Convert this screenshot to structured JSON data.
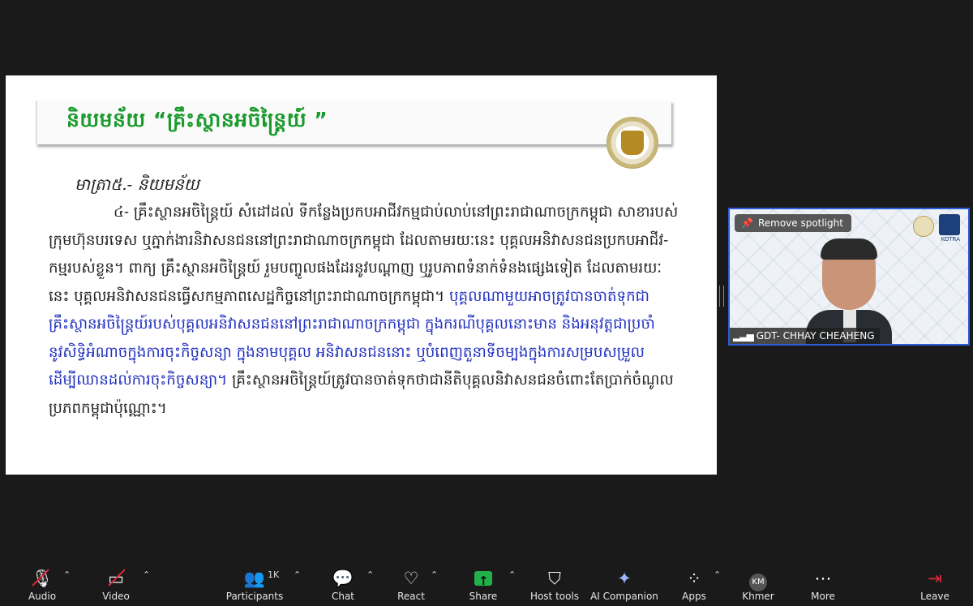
{
  "slide": {
    "title": "និយមន័យ “គ្រឹះស្ថានអចិន្ត្រៃយ៍ ”",
    "subtitle": "មាត្រា៥.- និយមន័យ",
    "body_lines": [
      "៤- គ្រឹះស្ថានអចិន្ត្រៃយ៍ សំដៅដល់ ទីកន្លែងប្រកបអាជីវកម្មជាប់លាប់នៅព្រះរាជាណាចក្រកម្ពុជា សាខារបស់",
      "ក្រុមហ៊ុនបរទេស ឬភ្នាក់ងារនិវាសនជននៅព្រះរាជាណាចក្រកម្ពុជា ដែលតាមរយៈនេះ បុគ្គលអនិវាសនជនប្រកបអាជីវ-",
      "កម្មរបស់ខ្លួន។ ពាក្យ គ្រឹះស្ថានអចិន្ត្រៃយ៍ រួមបញ្ចូលផងដែរនូវបណ្ដាញ ឬរូបភាពទំនាក់ទំនងផ្សេងទៀត ដែលតាមរយៈ",
      "នេះ បុគ្គលអនិវាសនជនធ្វើសកម្មភាពសេដ្ឋកិច្ចនៅព្រះរាជាណាចក្រកម្ពុជា។",
      "បុគ្គលណាមួយអាចត្រូវបានចាត់ទុកជា",
      "គ្រឹះស្ថានអចិន្ត្រៃយ៍របស់បុគ្គលអនិវាសនជននៅព្រះរាជាណាចក្រកម្ពុជា ក្នុងករណីបុគ្គលនោះមាន និងអនុវត្តជាប្រចាំ",
      "នូវសិទ្ធិអំណាចក្នុងការចុះកិច្ចសន្យា ក្នុងនាមបុគ្គល អនិវាសនជននោះ ឬបំពេញតួនាទីចម្បងក្នុងការសម្របសម្រួល",
      "ដើម្បីឈានដល់ការចុះកិច្ចសន្យា។",
      "គ្រឹះស្ថានអចិន្ត្រៃយ៍ត្រូវបានចាត់ទុកថាជានីតិបុគ្គលនិវាសនជនចំពោះតែប្រាក់ចំណូល",
      "ប្រភពកម្ពុជាប៉ុណ្ណោះ។"
    ]
  },
  "video": {
    "spotlight_label": "Remove spotlight",
    "participant_name": "GDT- CHHAY CHEAHENG",
    "logo_text": "KOTRA"
  },
  "toolbar": {
    "audio": "Audio",
    "video": "Video",
    "participants": "Participants",
    "participants_count": "1K",
    "chat": "Chat",
    "react": "React",
    "share": "Share",
    "host_tools": "Host tools",
    "ai_companion": "AI Companion",
    "apps": "Apps",
    "language": "Khmer",
    "language_avatar": "KM",
    "more": "More",
    "leave": "Leave"
  },
  "colors": {
    "title_green": "#1a9a2c",
    "highlight_blue": "#1f2fc0",
    "share_green": "#22b04b",
    "spotlight_border": "#2b5dd6"
  }
}
